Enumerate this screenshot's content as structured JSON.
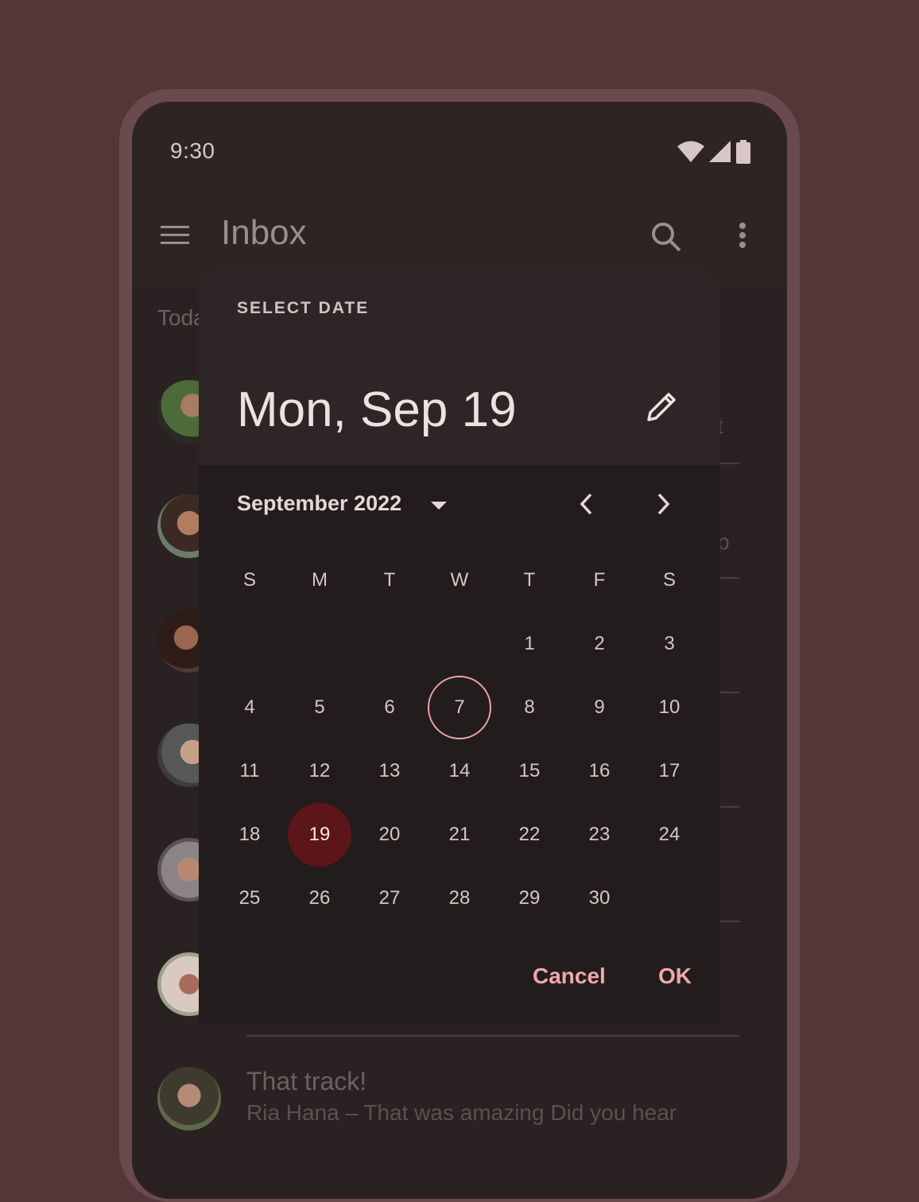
{
  "status_bar": {
    "time": "9:30",
    "icons": [
      "wifi-icon",
      "cellular-icon",
      "battery-icon"
    ]
  },
  "app_bar": {
    "title": "Inbox",
    "icons": [
      "menu-icon",
      "search-icon",
      "more-vert-icon"
    ]
  },
  "list": {
    "section_label": "Toda",
    "peeks": [
      "t",
      "p"
    ],
    "last_mail": {
      "subject": "That track!",
      "preview": "Ria Hana – That  was  amazing  Did you hear"
    }
  },
  "date_picker": {
    "supporting_text": "SELECT DATE",
    "headline": "Mon, Sep 19",
    "month_label": "September 2022",
    "weekdays": [
      "S",
      "M",
      "T",
      "W",
      "T",
      "F",
      "S"
    ],
    "first_weekday_index": 4,
    "days": [
      "1",
      "2",
      "3",
      "4",
      "5",
      "6",
      "7",
      "8",
      "9",
      "10",
      "11",
      "12",
      "13",
      "14",
      "15",
      "16",
      "17",
      "18",
      "19",
      "20",
      "21",
      "22",
      "23",
      "24",
      "25",
      "26",
      "27",
      "28",
      "29",
      "30"
    ],
    "today": "7",
    "selected": "19",
    "cancel_label": "Cancel",
    "ok_label": "OK"
  },
  "colors": {
    "background": "#543639",
    "surface": "#231c1d",
    "primary": "#f0a8ab",
    "selected_fill": "#5c1519"
  }
}
